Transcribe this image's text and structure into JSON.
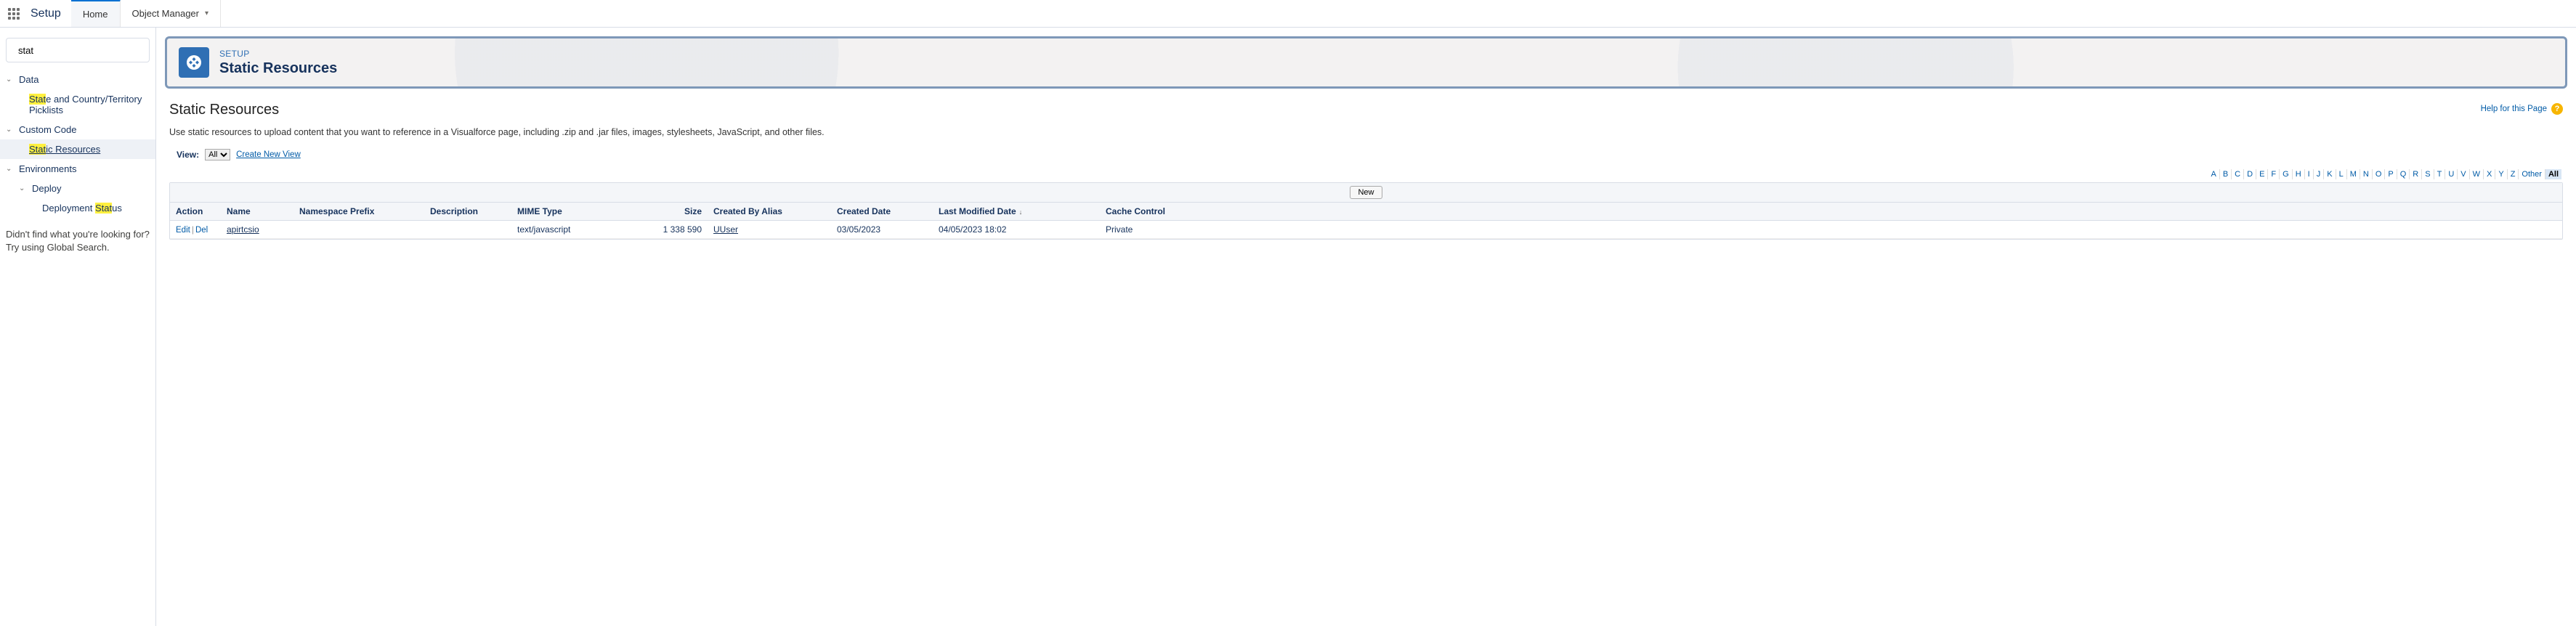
{
  "topbar": {
    "setup_label": "Setup",
    "tabs": [
      {
        "label": "Home",
        "active": true
      },
      {
        "label": "Object Manager",
        "active": false,
        "chevron": true
      }
    ]
  },
  "sidebar": {
    "search_value": "stat",
    "tree": [
      {
        "label": "Data",
        "children": [
          {
            "label_pre": "Stat",
            "label_mid": "e",
            "label_post": " and Country/Territory Picklists",
            "hl_len": 4,
            "leaf": true,
            "active": false
          }
        ]
      },
      {
        "label": "Custom Code",
        "children": [
          {
            "label_pre": "Stat",
            "label_post": "ic Resources",
            "hl_len": 4,
            "leaf": true,
            "active": true
          }
        ]
      },
      {
        "label": "Environments",
        "children": [
          {
            "label": "Deploy",
            "children": [
              {
                "label_pre": "Deployment ",
                "label_hl": "Stat",
                "label_post": "us",
                "leaf": true,
                "active": false
              }
            ]
          }
        ]
      }
    ],
    "not_found_1": "Didn't find what you're looking for?",
    "not_found_2": "Try using Global Search."
  },
  "band": {
    "crumb": "SETUP",
    "title": "Static Resources"
  },
  "page": {
    "title": "Static Resources",
    "help_label": "Help for this Page",
    "description": "Use static resources to upload content that you want to reference in a Visualforce page, including .zip and .jar files, images, stylesheets, JavaScript, and other files.",
    "view_label": "View:",
    "view_selected": "All",
    "create_view_label": "Create New View",
    "alpha": [
      "A",
      "B",
      "C",
      "D",
      "E",
      "F",
      "G",
      "H",
      "I",
      "J",
      "K",
      "L",
      "M",
      "N",
      "O",
      "P",
      "Q",
      "R",
      "S",
      "T",
      "U",
      "V",
      "W",
      "X",
      "Y",
      "Z",
      "Other",
      "All"
    ],
    "alpha_selected": "All",
    "new_button": "New",
    "columns": {
      "action": "Action",
      "name": "Name",
      "namespace": "Namespace Prefix",
      "description": "Description",
      "mime": "MIME Type",
      "size": "Size",
      "created_by": "Created By Alias",
      "created_date": "Created Date",
      "last_modified": "Last Modified Date",
      "cache": "Cache Control"
    },
    "action_edit": "Edit",
    "action_del": "Del",
    "rows": [
      {
        "name": "apirtcsio",
        "namespace": "",
        "description": "",
        "mime": "text/javascript",
        "size": "1 338 590",
        "created_by": "UUser",
        "created_date": "03/05/2023",
        "last_modified": "04/05/2023 18:02",
        "cache": "Private"
      }
    ]
  }
}
